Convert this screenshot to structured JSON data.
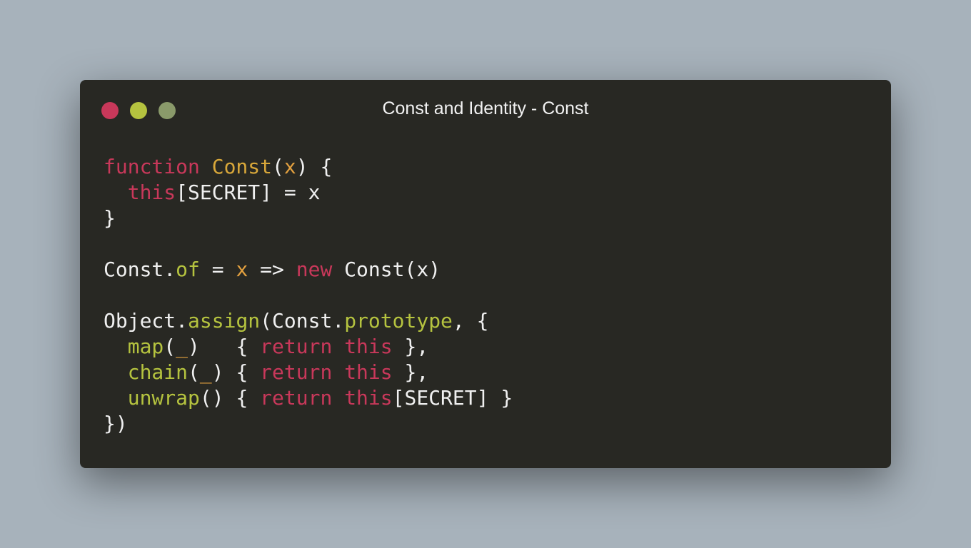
{
  "window": {
    "title": "Const and Identity - Const",
    "controls": [
      {
        "name": "close",
        "color": "#c8385a"
      },
      {
        "name": "minimize",
        "color": "#b5c33f"
      },
      {
        "name": "maximize",
        "color": "#8a9a6a"
      }
    ]
  },
  "code": {
    "lines": [
      [
        [
          "function",
          "keyword"
        ],
        [
          " ",
          "plain"
        ],
        [
          "Const",
          "class"
        ],
        [
          "(",
          "plain"
        ],
        [
          "x",
          "param"
        ],
        [
          ") {",
          "plain"
        ]
      ],
      [
        [
          "  ",
          "plain"
        ],
        [
          "this",
          "keyword"
        ],
        [
          "[SECRET] = x",
          "plain"
        ]
      ],
      [
        [
          "}",
          "plain"
        ]
      ],
      [],
      [
        [
          "Const.",
          "plain"
        ],
        [
          "of",
          "func"
        ],
        [
          " = ",
          "plain"
        ],
        [
          "x",
          "param"
        ],
        [
          " => ",
          "plain"
        ],
        [
          "new",
          "keyword"
        ],
        [
          " Const(x)",
          "plain"
        ]
      ],
      [],
      [
        [
          "Object.",
          "plain"
        ],
        [
          "assign",
          "func"
        ],
        [
          "(Const.",
          "plain"
        ],
        [
          "prototype",
          "func"
        ],
        [
          ", {",
          "plain"
        ]
      ],
      [
        [
          "  ",
          "plain"
        ],
        [
          "map",
          "func"
        ],
        [
          "(",
          "plain"
        ],
        [
          "_",
          "param"
        ],
        [
          ")   { ",
          "plain"
        ],
        [
          "return",
          "keyword"
        ],
        [
          " ",
          "plain"
        ],
        [
          "this",
          "keyword"
        ],
        [
          " },",
          "plain"
        ]
      ],
      [
        [
          "  ",
          "plain"
        ],
        [
          "chain",
          "func"
        ],
        [
          "(",
          "plain"
        ],
        [
          "_",
          "param"
        ],
        [
          ") { ",
          "plain"
        ],
        [
          "return",
          "keyword"
        ],
        [
          " ",
          "plain"
        ],
        [
          "this",
          "keyword"
        ],
        [
          " },",
          "plain"
        ]
      ],
      [
        [
          "  ",
          "plain"
        ],
        [
          "unwrap",
          "func"
        ],
        [
          "() { ",
          "plain"
        ],
        [
          "return",
          "keyword"
        ],
        [
          " ",
          "plain"
        ],
        [
          "this",
          "keyword"
        ],
        [
          "[SECRET] }",
          "plain"
        ]
      ],
      [
        [
          "})",
          "plain"
        ]
      ]
    ]
  }
}
